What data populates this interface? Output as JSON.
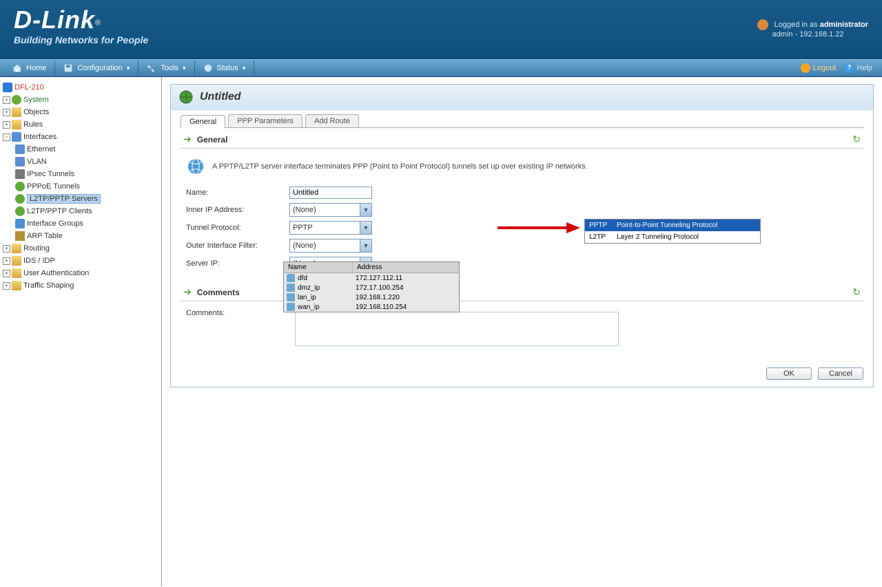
{
  "header": {
    "brand": "D-Link",
    "tagline": "Building Networks for People",
    "logged_in_prefix": "Logged in as ",
    "logged_in_user": "administrator",
    "sub_line": "admin - 192.168.1.22"
  },
  "menubar": {
    "home": "Home",
    "configuration": "Configuration",
    "tools": "Tools",
    "status": "Status",
    "logout": "Logout",
    "help": "Help"
  },
  "tree": {
    "root": "DFL-210",
    "system": "System",
    "objects": "Objects",
    "rules": "Rules",
    "interfaces": "Interfaces",
    "ethernet": "Ethernet",
    "vlan": "VLAN",
    "ipsec": "IPsec Tunnels",
    "pppoe": "PPPoE Tunnels",
    "l2tp_servers": "L2TP/PPTP Servers",
    "l2tp_clients": "L2TP/PPTP Clients",
    "interface_groups": "Interface Groups",
    "arp": "ARP Table",
    "routing": "Routing",
    "ids": "IDS / IDP",
    "user_auth": "User Authentication",
    "traffic_shaping": "Traffic Shaping"
  },
  "page": {
    "title": "Untitled",
    "tabs": {
      "general": "General",
      "ppp": "PPP Parameters",
      "add_route": "Add Route"
    },
    "section_general": "General",
    "description": "A PPTP/L2TP server interface terminates PPP (Point to Point Protocol) tunnels set up over existing IP networks.",
    "labels": {
      "name": "Name:",
      "inner_ip": "Inner IP Address:",
      "tunnel_protocol": "Tunnel Protocol:",
      "outer_filter": "Outer Interface Filter:",
      "server_ip": "Server IP:"
    },
    "values": {
      "name": "Untitled",
      "inner_ip": "(None)",
      "tunnel_protocol": "PPTP",
      "outer_filter": "(None)",
      "server_ip": "(None)"
    },
    "protocol_options": [
      {
        "code": "PPTP",
        "desc": "Point-to-Point Tunneling Protocol"
      },
      {
        "code": "L2TP",
        "desc": "Layer 2 Tunneling Protocol"
      }
    ],
    "serverip_headers": {
      "name": "Name",
      "address": "Address"
    },
    "serverip_options": [
      {
        "name": "dfd",
        "address": "172.127.112.11"
      },
      {
        "name": "dmz_ip",
        "address": "172.17.100.254"
      },
      {
        "name": "lan_ip",
        "address": "192.168.1.220"
      },
      {
        "name": "wan_ip",
        "address": "192.168.110.254"
      }
    ],
    "section_comments": "Comments",
    "comments_label": "Comments:",
    "buttons": {
      "ok": "OK",
      "cancel": "Cancel"
    }
  }
}
